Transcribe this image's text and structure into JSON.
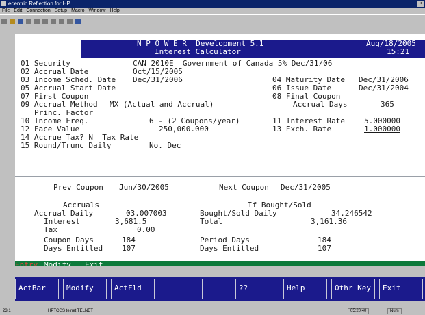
{
  "window": {
    "title": "ecentric Reflection for HP",
    "close_glyph": "×",
    "menus": [
      "File",
      "Edit",
      "Connection",
      "Setup",
      "Macro",
      "Window",
      "Help"
    ]
  },
  "toolbar": {
    "icons": [
      "new-icon",
      "open-icon",
      "save-icon",
      "print-icon",
      "cut-icon",
      "copy-icon",
      "paste-icon",
      "play-icon",
      "stop-icon",
      "help-icon"
    ]
  },
  "header": {
    "title": "N P O W E R  Development 5.1",
    "subtitle": "Interest Calculator",
    "date": "Aug/18/2005",
    "time": "15:21"
  },
  "fields": {
    "l01": "01 Security",
    "v01": "CAN 2010E  Government of Canada 5% Dec/31/06",
    "l02": "02 Accrual Date",
    "v02": "Oct/15/2005",
    "l03": "03 Income Sched. Date",
    "v03": "Dec/31/2006",
    "l04": "04 Maturity Date",
    "v04": "Dec/31/2006",
    "l05": "05 Accrual Start Date",
    "l06": "06 Issue Date",
    "v06": "Dec/31/2004",
    "l07": "07 First Coupon",
    "l08": "08 Final Coupon",
    "l09": "09 Accrual Method",
    "v09": "MX (Actual and Accrual)",
    "l_ad": "Accrual Days",
    "v_ad": "365",
    "l_pf": "Princ. Factor",
    "l10": "10 Income Freq.",
    "v10": "6 - (2 Coupons/year)",
    "l11": "11 Interest Rate",
    "v11": "5.000000",
    "l12": "12 Face Value",
    "v12": "250,000.000",
    "l13": "13 Exch. Rate",
    "v13": "1.000000",
    "l14": "14 Accrue Tax? N  Tax Rate",
    "l15": "15 Round/Trunc Daily",
    "v15": "No. Dec"
  },
  "results": {
    "prev_label": "Prev Coupon",
    "prev_value": "Jun/30/2005",
    "next_label": "Next Coupon",
    "next_value": "Dec/31/2005",
    "accruals_heading": "Accruals",
    "bought_heading": "If Bought/Sold",
    "accrual_daily_label": "Accrual Daily",
    "accrual_daily_value": "03.007003",
    "bought_daily_label": "Bought/Sold Daily",
    "bought_daily_value": "34.246542",
    "interest_label": "Interest",
    "interest_value": "3,681.5",
    "total_label": "Total",
    "total_value": "3,161.36",
    "tax_label": "Tax",
    "tax_value": "0.00",
    "coupon_days_label": "Coupon Days",
    "coupon_days_value": "184",
    "period_days_label": "Period Days",
    "period_days_value": "184",
    "days_entitled_label": "Days Entitled",
    "days_entitled_value": "107",
    "days_entitled2_label": "Days Entitled",
    "days_entitled2_value": "107"
  },
  "command_bar": {
    "entry": "Entry",
    "modify": "Modify",
    "exit": "Exit"
  },
  "function_keys": [
    "ActBar",
    "Modify",
    "ActFld",
    "",
    "??",
    "Help",
    "Othr Key",
    "Exit"
  ],
  "status": {
    "line": "23,1",
    "host": "HPTCGS  telnet TELNET",
    "position": "05:20:40",
    "mode": "Num"
  }
}
